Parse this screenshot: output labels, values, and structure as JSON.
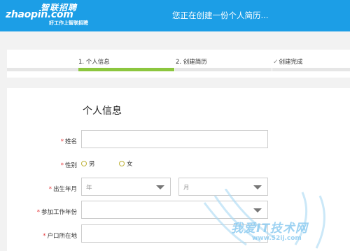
{
  "header": {
    "logo_cn": "智联招聘",
    "logo_en": "zhaopin.com",
    "logo_slogan": "好工作上智联招聘",
    "title": "您正在创建一份个人简历..."
  },
  "steps": [
    {
      "label": "1. 个人信息",
      "active": true
    },
    {
      "label": "2. 创建简历",
      "active": false
    },
    {
      "label": "创建完成",
      "active": false
    }
  ],
  "form": {
    "title": "个人信息",
    "required_mark": "*",
    "fields": {
      "name": {
        "label": "姓名",
        "value": ""
      },
      "gender": {
        "label": "性别",
        "options": [
          "男",
          "女"
        ]
      },
      "birth": {
        "label": "出生年月",
        "year_placeholder": "年",
        "month_placeholder": "月"
      },
      "work_year": {
        "label": "参加工作年份",
        "value": ""
      },
      "hukou": {
        "label": "户口所在地",
        "value": ""
      }
    }
  },
  "watermark": {
    "text": "我爱IT技术网",
    "url": "www.52ij.com"
  },
  "colors": {
    "header_bg": "#1c9ee6",
    "step_active": "#8cc63f",
    "required": "#e4393c"
  }
}
